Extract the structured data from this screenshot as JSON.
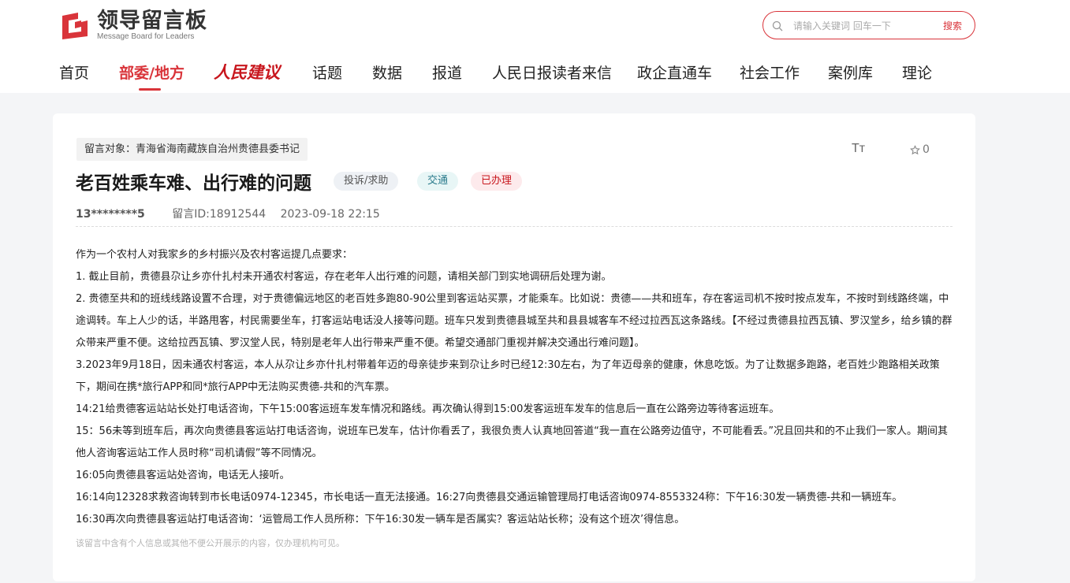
{
  "site": {
    "logo_cn": "领导留言板",
    "logo_en": "Message Board for Leaders",
    "accent_color": "#d9343a"
  },
  "search": {
    "placeholder": "请输入关键词 回车一下",
    "value": "",
    "button_label": "搜索",
    "icon": "search-icon"
  },
  "nav": {
    "items": [
      {
        "label": "首页"
      },
      {
        "label": "部委/地方",
        "active": true
      },
      {
        "label": "人民建议"
      },
      {
        "label": "话题"
      },
      {
        "label": "数据"
      },
      {
        "label": "报道"
      },
      {
        "label": "人民日报读者来信"
      },
      {
        "label": "政企直通车"
      },
      {
        "label": "社会工作"
      },
      {
        "label": "案例库"
      },
      {
        "label": "理论"
      }
    ]
  },
  "message": {
    "target": "留言对象：青海省海南藏族自治州贵德县委书记",
    "font_toggle": "Tт",
    "favorite_count": "0",
    "title": "老百姓乘车难、出行难的问题",
    "tags": {
      "type": "投诉/求助",
      "domain": "交通",
      "status": "已办理"
    },
    "author": "13********5",
    "message_id": "留言ID:18912544",
    "datetime": "2023-09-18 22:15",
    "paragraphs": [
      "作为一个农村人对我家乡的乡村振兴及农村客运提几点要求：",
      "1. 截止目前，贵德县尕让乡亦什扎村未开通农村客运，存在老年人出行难的问题，请相关部门到实地调研后处理为谢。",
      "2. 贵德至共和的班线线路设置不合理，对于贵德偏远地区的老百姓多跑80-90公里到客运站买票，才能乘车。比如说：贵德——共和班车，存在客运司机不按时按点发车，不按时到线路终端，中途调转。车上人少的话，半路甩客，村民需要坐车，打客运站电话没人接等问题。班车只发到贵德县城至共和县县城客车不经过拉西瓦这条路线。【不经过贵德县拉西瓦镇、罗汉堂乡，给乡镇的群众带来严重不便。这给拉西瓦镇、罗汉堂人民，特别是老年人出行带来严重不便。希望交通部门重视并解决交通出行难问题】。",
      " 3.2023年9月18日，因未通农村客运，本人从尕让乡亦什扎村带着年迈的母亲徒步来到尕让乡时已经12:30左右，为了年迈母亲的健康，休息吃饭。为了让数据多跑路，老百姓少跑路相关政策下，期间在携*旅行APP和同*旅行APP中无法购买贵德-共和的汽车票。",
      "14:21给贵德客运站站长处打电话咨询，下午15:00客运班车发车情况和路线。再次确认得到15:00发客运班车发车的信息后一直在公路旁边等待客运班车。",
      "15：56未等到班车后，再次向贵德县客运站打电话咨询，说班车已发车，估计你看丢了，我很负责人认真地回答道“我一直在公路旁边值守，不可能看丢。”况且回共和的不止我们一家人。期间其他人咨询客运站工作人员时称“司机请假”等不同情况。",
      "16:05向贵德县客运站处咨询，电话无人接听。",
      "16:14向12328求救咨询转到市长电话0974-12345，市长电话一直无法接通。16:27向贵德县交通运输管理局打电话咨询0974-8553324称：下午16:30发一辆贵德-共和一辆班车。",
      "16:30再次向贵德县客运站打电话咨询：‘运管局工作人员所称：下午16:30发一辆车是否属实？客运站站长称；没有这个班次’得信息。"
    ],
    "privacy_notice": "该留言中含有个人信息或其他不便公开展示的内容，仅办理机构可见。"
  }
}
